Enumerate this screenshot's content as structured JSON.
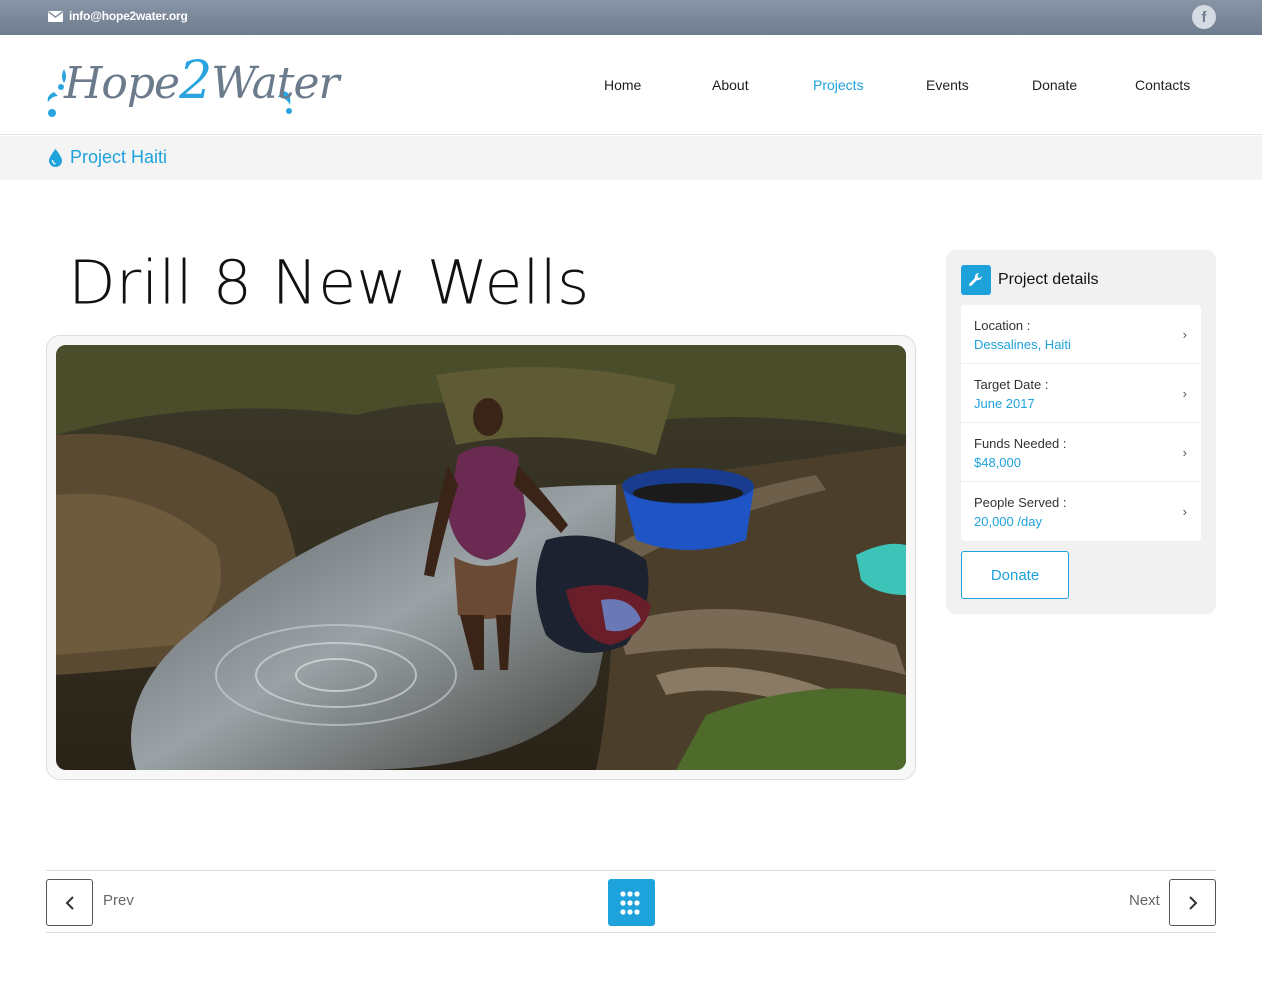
{
  "topbar": {
    "email": "info@hope2water.org",
    "email_icon": "envelope-icon",
    "social_icon": "facebook-icon",
    "social_letter": "f"
  },
  "logo": {
    "text_before": "Hope",
    "text_two": "2",
    "text_after": "Water",
    "accent_color": "#2aa4de",
    "text_color": "#6b7b8c"
  },
  "nav": {
    "items": [
      {
        "label": "Home",
        "active": false
      },
      {
        "label": "About",
        "active": false
      },
      {
        "label": "Projects",
        "active": true
      },
      {
        "label": "Events",
        "active": false
      },
      {
        "label": "Donate",
        "active": false
      },
      {
        "label": "Contacts",
        "active": false
      }
    ],
    "active_color": "#1ea2dc"
  },
  "breadcrumb": {
    "icon": "water-drop-icon",
    "label": "Project Haiti"
  },
  "page": {
    "title": "Drill 8 New Wells"
  },
  "details": {
    "header": "Project details",
    "icon": "wrench-icon",
    "rows": [
      {
        "key": "Location :",
        "value": "Dessalines, Haiti"
      },
      {
        "key": "Target Date :",
        "value": "June 2017"
      },
      {
        "key": "Funds Needed :",
        "value": "$48,000"
      },
      {
        "key": "People Served :",
        "value": "20,000 /day"
      }
    ],
    "donate_label": "Donate"
  },
  "pager": {
    "prev_label": "Prev",
    "next_label": "Next",
    "grid_icon": "grid-icon"
  }
}
